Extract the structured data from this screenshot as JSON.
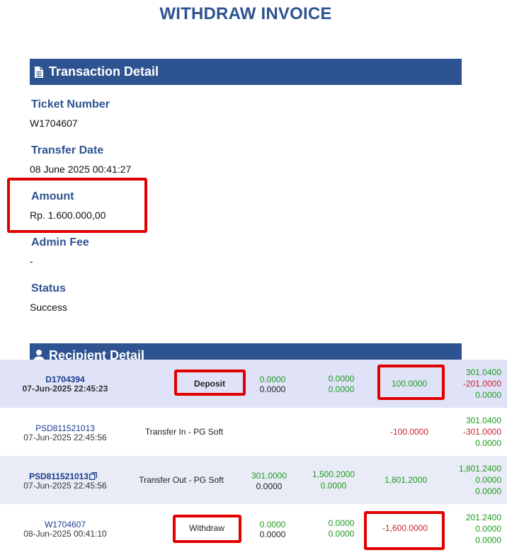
{
  "title": "WITHDRAW INVOICE",
  "transaction_section": {
    "label": "Transaction Detail",
    "icon": "document-icon"
  },
  "fields": {
    "ticket_number": {
      "label": "Ticket Number",
      "value": "W1704607"
    },
    "transfer_date": {
      "label": "Transfer Date",
      "value": "08 June 2025 00:41:27"
    },
    "amount": {
      "label": "Amount",
      "value": "Rp. 1.600.000,00"
    },
    "admin_fee": {
      "label": "Admin Fee",
      "value": "-"
    },
    "status": {
      "label": "Status",
      "value": "Success"
    }
  },
  "recipient_section": {
    "label": "Recipient Detail",
    "icon": "user-icon"
  },
  "colors": {
    "brand": "#2e5391",
    "green": "#1f9a1f",
    "red": "#c8242a",
    "highlight": "#e00000"
  },
  "rows": [
    {
      "ticket": "D1704394",
      "date": "07-Jun-2025 22:45:23",
      "type": "Deposit",
      "col1": [
        "0.0000",
        "0.0000"
      ],
      "col2": [
        "0.0000",
        "0.0000"
      ],
      "amount": "100.0000",
      "balance": [
        "301.0400",
        "-201.0000",
        "0.0000"
      ]
    },
    {
      "ticket": "PSD811521013",
      "date": "07-Jun-2025 22:45:56",
      "type": "Transfer In - PG Soft",
      "col1": [
        "",
        ""
      ],
      "col2": [
        "",
        ""
      ],
      "amount": "-100.0000",
      "balance": [
        "301.0400",
        "-301.0000",
        "0.0000"
      ]
    },
    {
      "ticket": "PSD811521013",
      "date": "07-Jun-2025 22:45:56",
      "type": "Transfer Out - PG Soft",
      "col1": [
        "301.0000",
        "0.0000"
      ],
      "col2": [
        "1,500.2000",
        "0.0000"
      ],
      "amount": "1,801.2000",
      "balance": [
        "1,801.2400",
        "0.0000",
        "0.0000"
      ]
    },
    {
      "ticket": "W1704607",
      "date": "08-Jun-2025 00:41:10",
      "type": "Withdraw",
      "col1": [
        "0.0000",
        "0.0000"
      ],
      "col2": [
        "0.0000",
        "0.0000"
      ],
      "amount": "-1,600.0000",
      "balance": [
        "201.2400",
        "0.0000",
        "0.0000"
      ]
    }
  ]
}
